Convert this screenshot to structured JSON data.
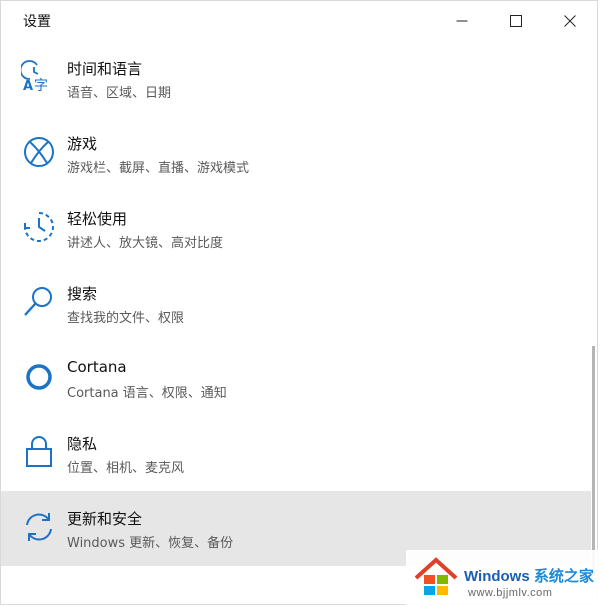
{
  "window": {
    "title": "设置",
    "accent_color": "#1a73c8"
  },
  "items": [
    {
      "label": "时间和语言",
      "desc": "语音、区域、日期",
      "icon": "time-language-icon"
    },
    {
      "label": "游戏",
      "desc": "游戏栏、截屏、直播、游戏模式",
      "icon": "xbox-icon"
    },
    {
      "label": "轻松使用",
      "desc": "讲述人、放大镜、高对比度",
      "icon": "ease-of-access-icon"
    },
    {
      "label": "搜索",
      "desc": "查找我的文件、权限",
      "icon": "search-icon"
    },
    {
      "label": "Cortana",
      "desc": "Cortana 语言、权限、通知",
      "icon": "cortana-icon"
    },
    {
      "label": "隐私",
      "desc": "位置、相机、麦克风",
      "icon": "lock-icon"
    },
    {
      "label": "更新和安全",
      "desc": "Windows 更新、恢复、备份",
      "icon": "update-icon"
    }
  ],
  "watermark": {
    "word1": "Windows",
    "word2": "系统之家",
    "url": "www.bjjmlv.com"
  }
}
